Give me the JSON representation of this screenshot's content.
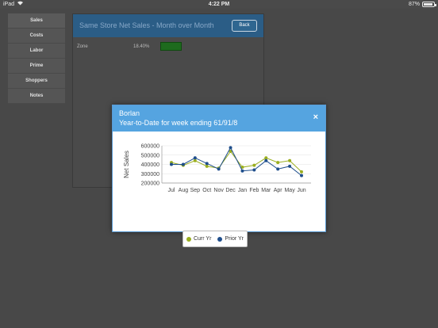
{
  "status": {
    "carrier": "iPad",
    "time": "4:22 PM",
    "battery": "87%"
  },
  "sidebar": {
    "items": [
      {
        "label": "Sales"
      },
      {
        "label": "Costs"
      },
      {
        "label": "Labor"
      },
      {
        "label": "Prime"
      },
      {
        "label": "Shoppers"
      },
      {
        "label": "Notes"
      }
    ]
  },
  "panel": {
    "title": "Same Store Net Sales - Month over Month",
    "back_label": "Back",
    "row": {
      "label": "Zone",
      "value": "18.40%"
    }
  },
  "modal": {
    "title": "Borlan",
    "subtitle": "Year-to-Date for week ending 61/91/8",
    "close_label": "×"
  },
  "colors": {
    "curr": "#9aae1f",
    "prior": "#1f4e8c",
    "header": "#55a4e0"
  },
  "chart_data": {
    "type": "line",
    "categories": [
      "Jul",
      "Aug",
      "Sep",
      "Oct",
      "Nov",
      "Dec",
      "Jan",
      "Feb",
      "Mar",
      "Apr",
      "May",
      "Jun"
    ],
    "ylabel": "Net Sales",
    "ylim": [
      200000,
      600000
    ],
    "yticks": [
      "200000",
      "300000",
      "400000",
      "500000",
      "600000"
    ],
    "grid": true,
    "legend_position": "bottom",
    "series": [
      {
        "name": "Curr Yr",
        "values": [
          420000,
          390000,
          440000,
          380000,
          360000,
          540000,
          370000,
          390000,
          470000,
          420000,
          440000,
          320000
        ]
      },
      {
        "name": "Prior Yr",
        "values": [
          400000,
          400000,
          470000,
          410000,
          350000,
          580000,
          330000,
          340000,
          440000,
          350000,
          380000,
          280000
        ]
      }
    ]
  }
}
